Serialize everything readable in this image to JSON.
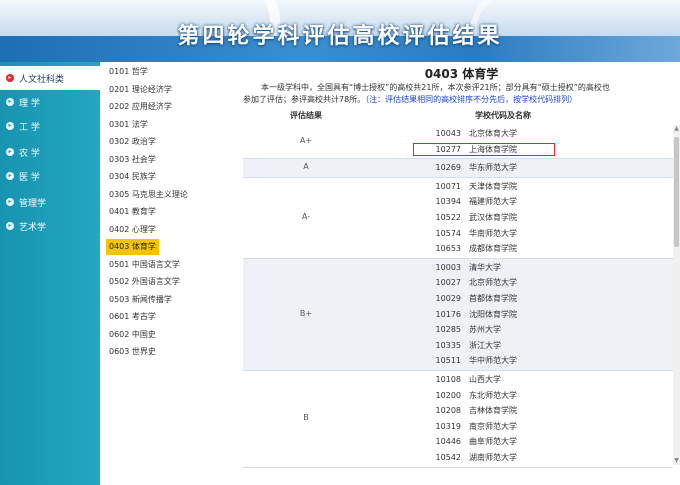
{
  "header": {
    "title": "第四轮学科评估高校评估结果"
  },
  "leftnav": {
    "items": [
      {
        "label": "人文社科类",
        "active": true
      },
      {
        "label": "理 学",
        "active": false
      },
      {
        "label": "工 学",
        "active": false
      },
      {
        "label": "农 学",
        "active": false
      },
      {
        "label": "医 学",
        "active": false
      },
      {
        "label": "管理学",
        "active": false
      },
      {
        "label": "艺术学",
        "active": false
      }
    ]
  },
  "subjects": [
    "0101 哲学",
    "0201 理论经济学",
    "0202 应用经济学",
    "0301 法学",
    "0302 政治学",
    "0303 社会学",
    "0304 民族学",
    "0305 马克思主义理论",
    "0401 教育学",
    "0402 心理学",
    "0403 体育学",
    "0501 中国语言文学",
    "0502 外国语言文学",
    "0503 新闻传播学",
    "0601 考古学",
    "0602 中国史",
    "0603 世界史"
  ],
  "main": {
    "title": "0403 体育学",
    "desc_line1": "本一级学科中，全国具有“博士授权”的高校共21所，本次参评21所；部分具有“硕士授权”的高校也",
    "desc_line2_prefix": "参加了评估；参评高校共计78所。",
    "desc_line2_note": "（注：评估结果相同的高校排序不分先后，按学校代码排列）",
    "col_grade": "评估结果",
    "col_school": "学校代码及名称"
  },
  "results": [
    {
      "grade": "A+",
      "rows": [
        {
          "code": "10043",
          "name": "北京体育大学"
        },
        {
          "code": "10277",
          "name": "上海体育学院"
        }
      ]
    },
    {
      "grade": "A",
      "rows": [
        {
          "code": "10269",
          "name": "华东师范大学"
        }
      ]
    },
    {
      "grade": "A-",
      "rows": [
        {
          "code": "10071",
          "name": "天津体育学院"
        },
        {
          "code": "10394",
          "name": "福建师范大学"
        },
        {
          "code": "10522",
          "name": "武汉体育学院"
        },
        {
          "code": "10574",
          "name": "华南师范大学"
        },
        {
          "code": "10653",
          "name": "成都体育学院"
        }
      ]
    },
    {
      "grade": "B+",
      "rows": [
        {
          "code": "10003",
          "name": "清华大学"
        },
        {
          "code": "10027",
          "name": "北京师范大学"
        },
        {
          "code": "10029",
          "name": "首都体育学院"
        },
        {
          "code": "10176",
          "name": "沈阳体育学院"
        },
        {
          "code": "10285",
          "name": "苏州大学"
        },
        {
          "code": "10335",
          "name": "浙江大学"
        },
        {
          "code": "10511",
          "name": "华中师范大学"
        }
      ]
    },
    {
      "grade": "B",
      "rows": [
        {
          "code": "10108",
          "name": "山西大学"
        },
        {
          "code": "10200",
          "name": "东北师范大学"
        },
        {
          "code": "10208",
          "name": "吉林体育学院"
        },
        {
          "code": "10319",
          "name": "南京师范大学"
        },
        {
          "code": "10446",
          "name": "曲阜师范大学"
        },
        {
          "code": "10542",
          "name": "湖南师范大学"
        }
      ]
    }
  ],
  "highlighted_school": "10277 上海体育学院"
}
